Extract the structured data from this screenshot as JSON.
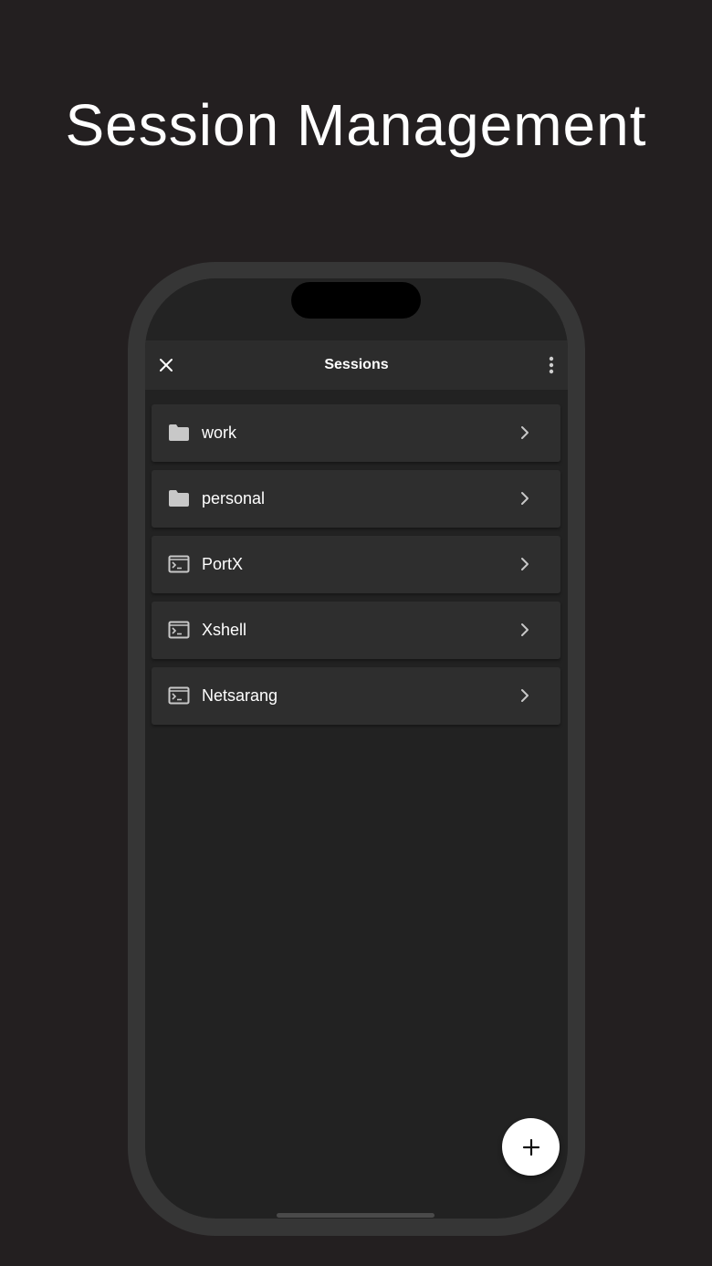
{
  "headline": "Session Management",
  "app": {
    "title": "Sessions",
    "close_icon": "close-icon",
    "more_icon": "more-vertical-icon"
  },
  "sessions": [
    {
      "label": "work",
      "icon": "folder-icon",
      "type": "folder"
    },
    {
      "label": "personal",
      "icon": "folder-icon",
      "type": "folder"
    },
    {
      "label": "PortX",
      "icon": "terminal-icon",
      "type": "session"
    },
    {
      "label": "Xshell",
      "icon": "terminal-icon",
      "type": "session"
    },
    {
      "label": "Netsarang",
      "icon": "terminal-icon",
      "type": "session"
    }
  ],
  "fab": {
    "icon": "plus-icon"
  },
  "colors": {
    "background": "#231f20",
    "frame": "#363636",
    "screen": "#222222",
    "topbar": "#2c2c2c",
    "row": "#2e2e2e",
    "icon": "#c8c8c8",
    "fab": "#ffffff"
  }
}
